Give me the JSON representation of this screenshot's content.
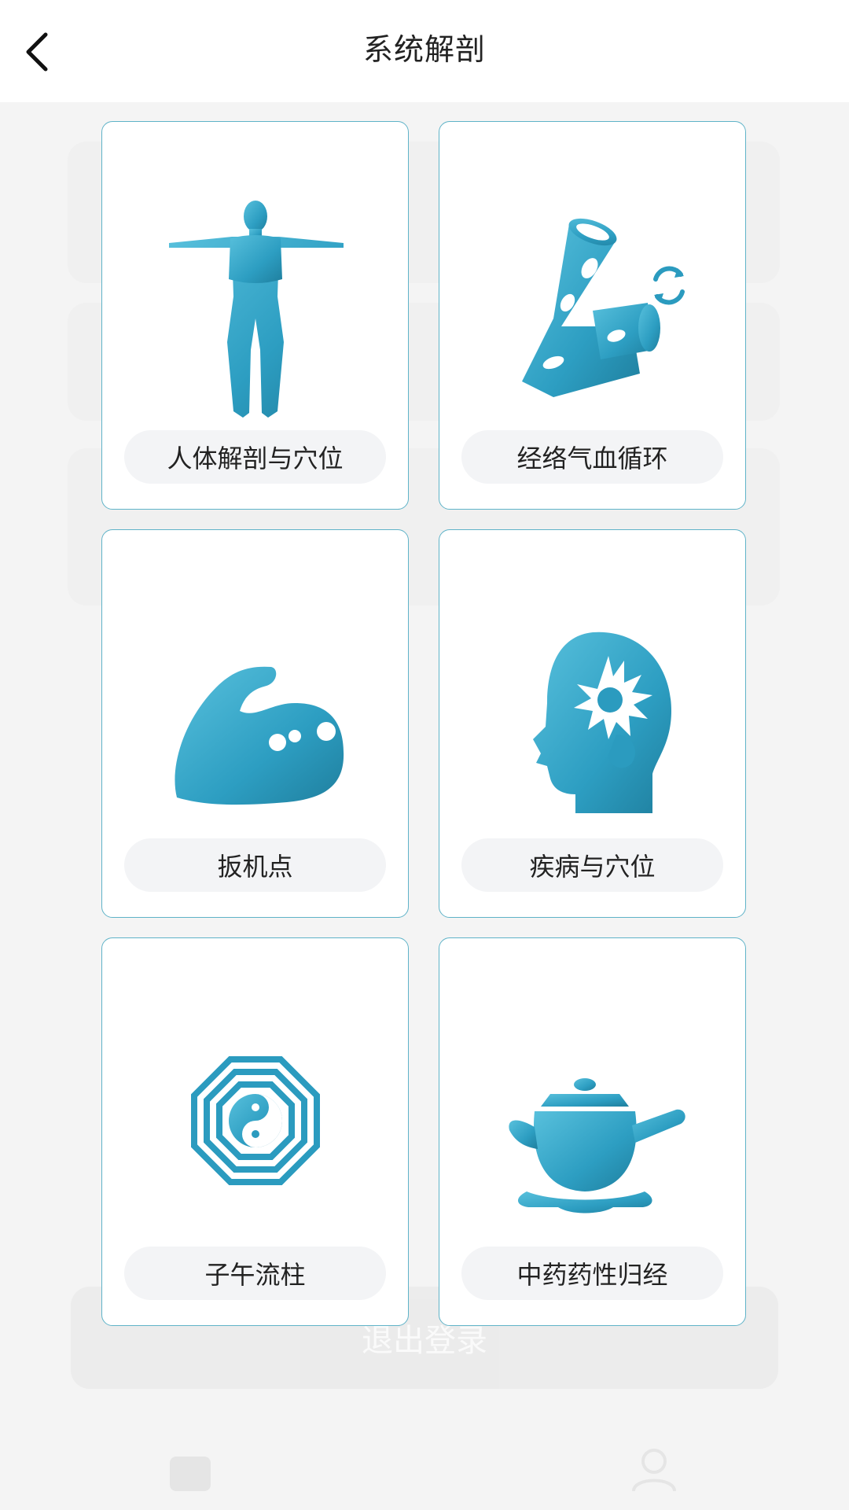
{
  "header": {
    "title": "系统解剖"
  },
  "cards": [
    {
      "label": "人体解剖与穴位",
      "icon": "human-body-icon"
    },
    {
      "label": "经络气血循环",
      "icon": "meridian-pipe-icon"
    },
    {
      "label": "扳机点",
      "icon": "flexed-arm-icon"
    },
    {
      "label": "疾病与穴位",
      "icon": "head-brain-icon"
    },
    {
      "label": "子午流柱",
      "icon": "bagua-yinyang-icon"
    },
    {
      "label": "中药药性归经",
      "icon": "teapot-icon"
    }
  ],
  "background": {
    "logout_label": "退出登录"
  },
  "colors": {
    "accent": "#2b9bbf",
    "card_border": "#5fb3c8",
    "label_bg": "#f3f4f6"
  }
}
